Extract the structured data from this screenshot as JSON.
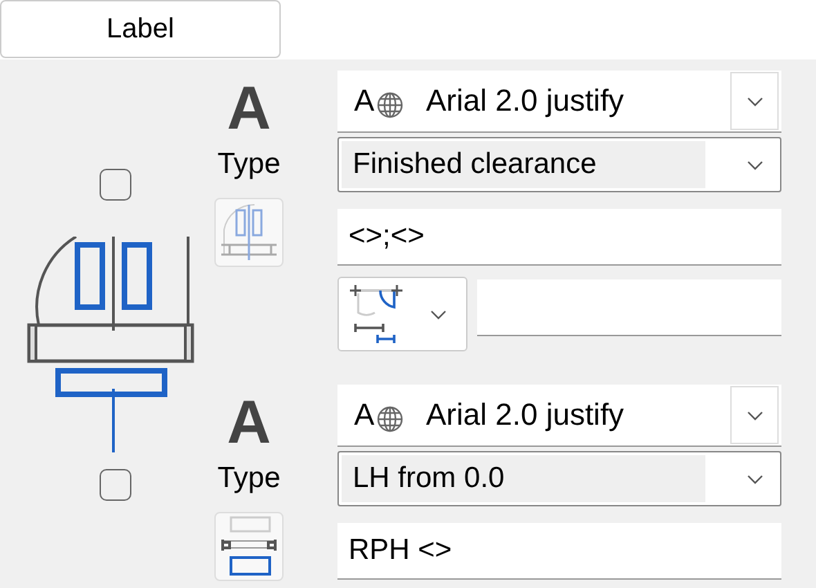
{
  "top_button": {
    "label": "Label"
  },
  "top_checkbox": {
    "checked": false
  },
  "bottom_checkbox": {
    "checked": false
  },
  "sections": [
    {
      "heading": "A",
      "type_label": "Type",
      "kind": "door",
      "font": {
        "icon_letter": "A",
        "value": "Arial 2.0 justify"
      },
      "mode": {
        "value": "Finished clearance"
      },
      "rows": [
        {
          "kind": "field",
          "value": "<>;<>"
        },
        {
          "kind": "icon-dropdown-field"
        }
      ]
    },
    {
      "heading": "A",
      "type_label": "Type",
      "kind": "frame",
      "font": {
        "icon_letter": "A",
        "value": "Arial 2.0 justify"
      },
      "mode": {
        "value": "LH from 0.0"
      },
      "rows": [
        {
          "kind": "field",
          "value": "RPH <>"
        }
      ]
    }
  ]
}
